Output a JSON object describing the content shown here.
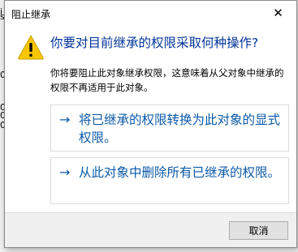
{
  "background": {
    "glyphs": [
      "i",
      "0",
      "sá",
      "0",
      "0",
      "0"
    ]
  },
  "dialog": {
    "title": "阻止继承",
    "close_glyph": "✕",
    "question": "你要对目前继承的权限采取何种操作?",
    "description": "你将要阻止此对象继承权限，这意味着从父对象中继承的权限不再适用于此对象。",
    "commands": [
      {
        "arrow": "→",
        "label": "将已继承的权限转换为此对象的显式权限。"
      },
      {
        "arrow": "→",
        "label": "从此对象中删除所有已继承的权限。"
      }
    ],
    "cancel_label": "取消"
  },
  "colors": {
    "warning": "#f7c600",
    "link": "#0b5aa8",
    "heading": "#003399"
  },
  "icons": {
    "warning": "warning-triangle-icon",
    "close": "close-icon",
    "arrow": "arrow-right-icon"
  }
}
